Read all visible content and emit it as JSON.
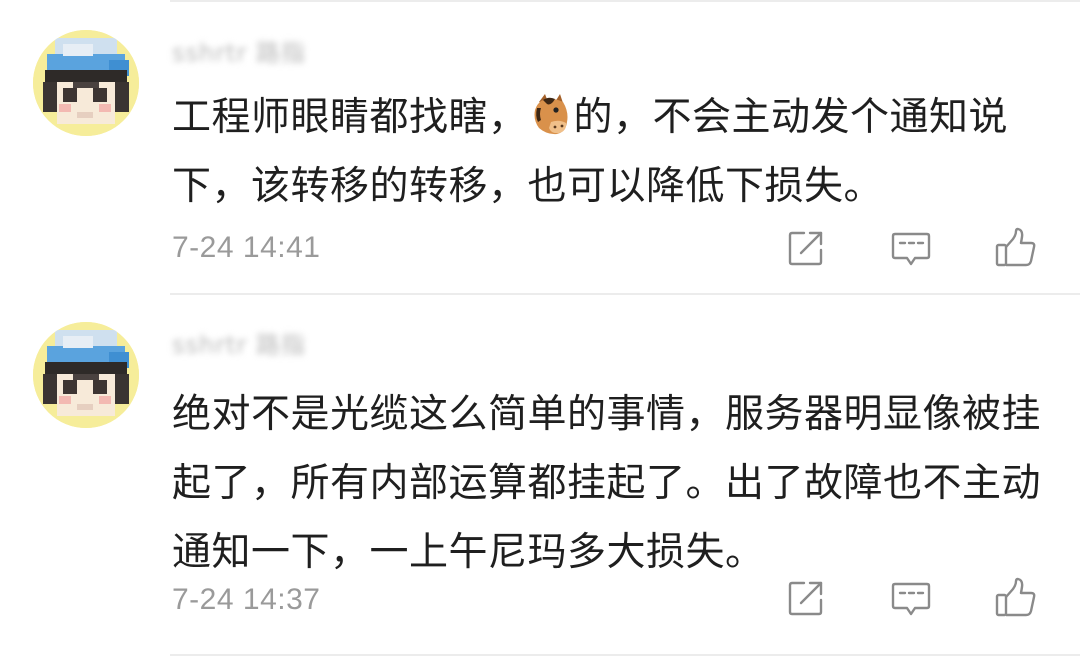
{
  "comments": [
    {
      "username": "sshrtr 路指",
      "text_before_emoji": "工程师眼睛都找瞎，",
      "emoji": "horse-face-emoji",
      "text_after_emoji": "的，不会主动发个通知说下，该转移的转移，也可以降低下损失。",
      "timestamp": "7-24 14:41"
    },
    {
      "username": "sshrtr 路指",
      "text": "绝对不是光缆这么简单的事情，服务器明显像被挂起了，所有内部运算都挂起了。出了故障也不主动通知一下，一上午尼玛多大损失。",
      "timestamp": "7-24 14:37"
    }
  ],
  "icons": {
    "share": "share-icon",
    "reply": "comment-icon",
    "like": "thumbs-up-icon"
  },
  "colors": {
    "text": "#1f1f1f",
    "meta": "#9a9a9a",
    "icon": "#8a8a8a",
    "divider": "#ececec",
    "avatar_bg": "#f6ed9a"
  }
}
